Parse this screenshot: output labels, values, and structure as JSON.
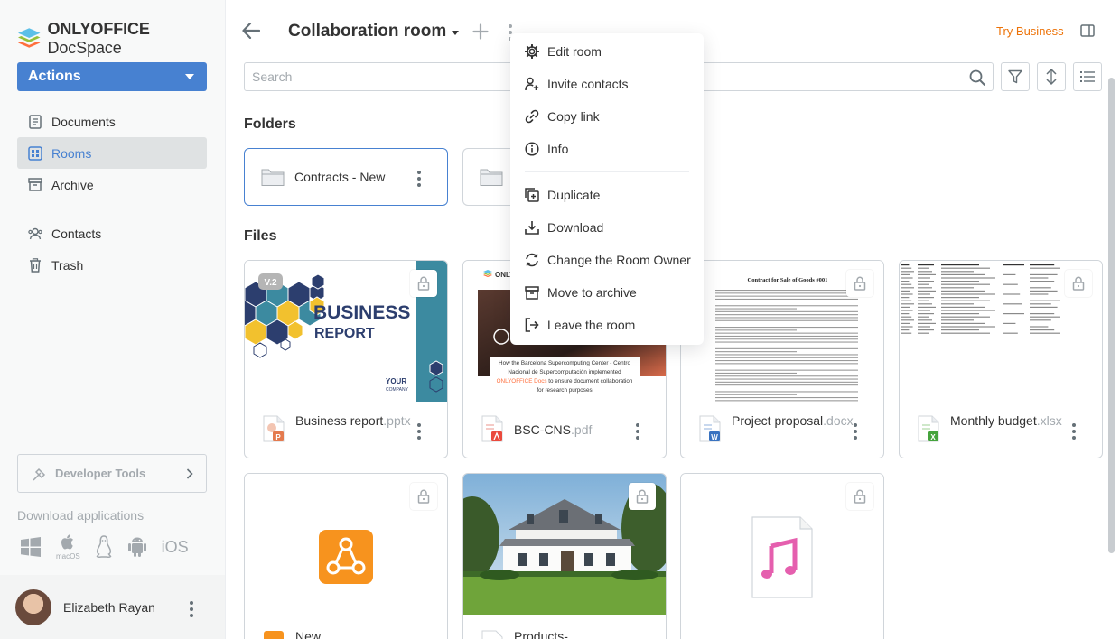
{
  "app": {
    "logo_brand": "ONLYOFFICE",
    "logo_product": "DocSpace"
  },
  "sidebar": {
    "actions_label": "Actions",
    "items": [
      {
        "label": "Documents",
        "icon": "documents-icon"
      },
      {
        "label": "Rooms",
        "icon": "rooms-icon",
        "active": true
      },
      {
        "label": "Archive",
        "icon": "archive-icon"
      }
    ],
    "items2": [
      {
        "label": "Contacts",
        "icon": "contacts-icon"
      },
      {
        "label": "Trash",
        "icon": "trash-icon"
      }
    ],
    "developer_tools": "Developer Tools",
    "download_apps": "Download applications",
    "os_macos": "macOS",
    "os_ios": "iOS",
    "user_name": "Elizabeth Rayan"
  },
  "header": {
    "room_title": "Collaboration room",
    "try_business": "Try Business"
  },
  "search": {
    "placeholder": "Search"
  },
  "sections": {
    "folders": "Folders",
    "files": "Files"
  },
  "folders": [
    {
      "name": "Contracts - New",
      "selected": true
    },
    {
      "name": ""
    }
  ],
  "files": [
    {
      "name": "Business report",
      "ext": ".pptx",
      "badge": "V.2",
      "thumb_title": "BUSINESS",
      "thumb_sub": "REPORT",
      "thumb_corner": "YOUR",
      "thumb_corner2": "COMPANY"
    },
    {
      "name": "BSC-CNS",
      "ext": ".pdf",
      "thumb_logo": "ONLY",
      "thumb_caption_1": "How the Barcelona Supercomputing Center - Centro",
      "thumb_caption_2": "Nacional de Supercomputación implemented",
      "thumb_caption_3_accent": "ONLYOFFICE Docs",
      "thumb_caption_3": " to ensure document collaboration",
      "thumb_caption_4": "for research purposes"
    },
    {
      "name": "Project proposal",
      "ext": ".docx",
      "thumb_title": "Contract for Sale of Goods #001"
    },
    {
      "name": "Monthly budget",
      "ext": ".xlsx"
    },
    {
      "name": "New",
      "ext": ""
    },
    {
      "name": "Products-",
      "ext": ""
    },
    {
      "name": "",
      "ext": ""
    }
  ],
  "context_menu": {
    "items": [
      {
        "label": "Edit room",
        "icon": "gear-icon"
      },
      {
        "label": "Invite contacts",
        "icon": "invite-contacts-icon"
      },
      {
        "label": "Copy link",
        "icon": "link-icon"
      },
      {
        "label": "Info",
        "icon": "info-icon"
      },
      {
        "label": "Duplicate",
        "icon": "duplicate-icon"
      },
      {
        "label": "Download",
        "icon": "download-icon"
      },
      {
        "label": "Change the Room Owner",
        "icon": "change-owner-icon"
      },
      {
        "label": "Move to archive",
        "icon": "archive-icon"
      },
      {
        "label": "Leave the room",
        "icon": "leave-icon"
      }
    ]
  },
  "colors": {
    "accent": "#4781d1",
    "try_business": "#ed7309",
    "pptx": "#e47a4e",
    "pdf": "#ea4a3d",
    "docx": "#3a73c0",
    "xlsx": "#45a33c"
  }
}
